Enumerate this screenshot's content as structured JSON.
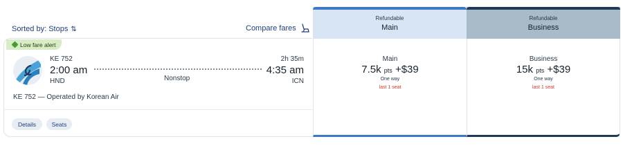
{
  "sort": {
    "label": "Sorted by: Stops",
    "icon": "sort-arrows-icon"
  },
  "compare": {
    "label": "Compare fares",
    "icon": "seat-icon"
  },
  "colors": {
    "main_accent": "#3d78c8",
    "business_accent": "#1e3a56",
    "alert_green": "#d8ecc5",
    "seat_warning": "#d33a2c"
  },
  "flight": {
    "badge": "Low fare alert",
    "number": "KE 752",
    "depart_time": "2:00 am",
    "depart_code": "HND",
    "duration": "2h 35m",
    "arrive_time": "4:35 am",
    "arrive_code": "ICN",
    "stops": "Nonstop",
    "operated_by": "KE 752 — Operated by Korean Air",
    "details_label": "Details",
    "seats_label": "Seats"
  },
  "fares": [
    {
      "header_refund": "Refundable",
      "header_cabin": "Main",
      "cabin": "Main",
      "points": "7.5k",
      "pts_unit": "pts",
      "cash": "+$39",
      "trip": "One way",
      "availability": "last 1 seat"
    },
    {
      "header_refund": "Refundable",
      "header_cabin": "Business",
      "cabin": "Business",
      "points": "15k",
      "pts_unit": "pts",
      "cash": "+$39",
      "trip": "One way",
      "availability": "last 1 seat"
    }
  ]
}
